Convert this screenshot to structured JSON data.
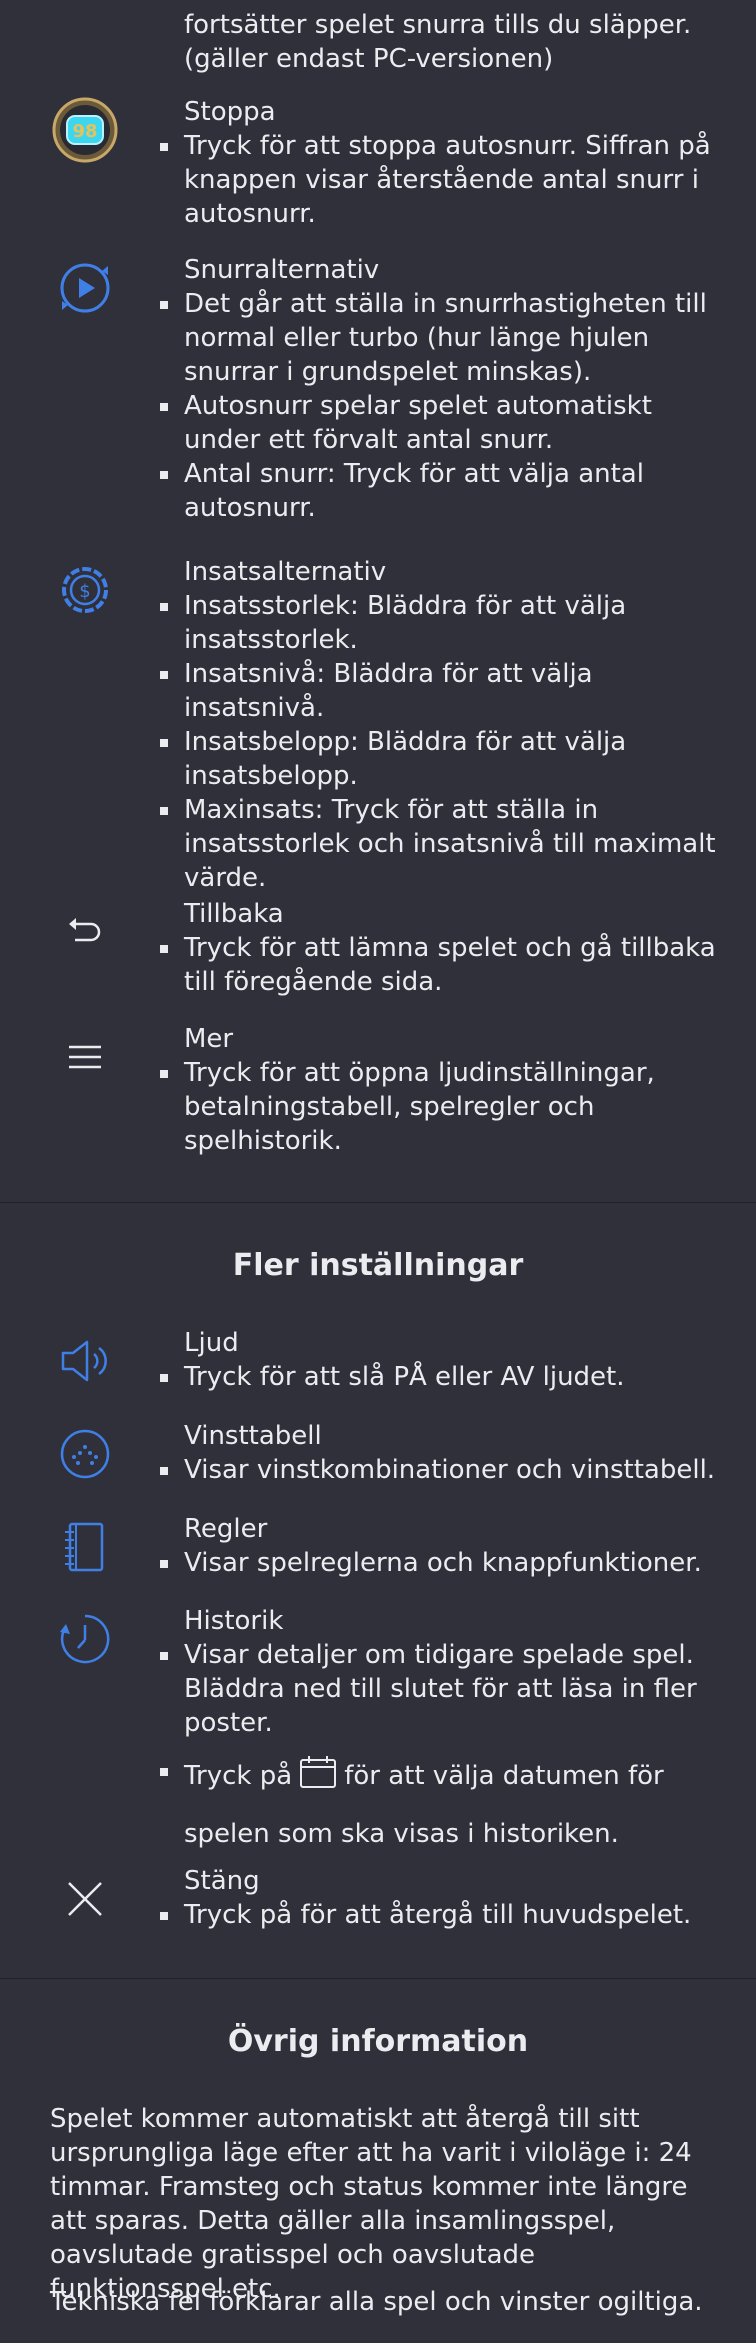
{
  "top_fragment": {
    "line1": "fortsätter spelet snurra tills du släpper.",
    "line2": "(gäller endast PC-versionen)"
  },
  "controls": {
    "stop": {
      "icon": "stop-badge-icon",
      "badge_number": "98",
      "title": "Stoppa",
      "bullets": [
        "Tryck för att stoppa autosnurr. Siffran på knappen visar återstående antal snurr i autosnurr."
      ]
    },
    "spin_options": {
      "icon": "play-circle-icon",
      "title": "Snurralternativ",
      "bullets": [
        "Det går att ställa in snurrhastigheten till normal eller turbo (hur länge hjulen snurrar i grundspelet minskas).",
        "Autosnurr spelar spelet automatiskt under ett förvalt antal snurr.",
        "Antal snurr: Tryck för att välja antal autosnurr."
      ]
    },
    "bet_options": {
      "icon": "coin-gear-icon",
      "title": "Insatsalternativ",
      "bullets": [
        "Insatsstorlek: Bläddra för att välja insatsstorlek.",
        "Insatsnivå: Bläddra för att välja insatsnivå.",
        "Insatsbelopp: Bläddra för att välja insatsbelopp.",
        "Maxinsats: Tryck för att ställa in insatsstorlek och insatsnivå till maximalt värde."
      ]
    },
    "back": {
      "icon": "back-arrow-icon",
      "title": "Tillbaka",
      "bullets": [
        "Tryck för att lämna spelet och gå tillbaka till föregående sida."
      ]
    },
    "more": {
      "icon": "menu-icon",
      "title": "Mer",
      "bullets": [
        "Tryck för att öppna ljudinställningar, betalningstabell, spelregler och spelhistorik."
      ]
    }
  },
  "more_settings": {
    "heading": "Fler inställningar",
    "sound": {
      "icon": "speaker-icon",
      "title": "Ljud",
      "bullets": [
        "Tryck för att slå PÅ eller AV ljudet."
      ]
    },
    "paytable": {
      "icon": "dots-circle-icon",
      "title": "Vinsttabell",
      "bullets": [
        "Visar vinstkombinationer och vinsttabell."
      ]
    },
    "rules": {
      "icon": "notebook-icon",
      "title": "Regler",
      "bullets": [
        "Visar spelreglerna och knappfunktioner."
      ]
    },
    "history": {
      "icon": "clock-icon",
      "title": "Historik",
      "bullets": [
        "Visar detaljer om tidigare spelade spel. Bläddra ned till slutet för att läsa in fler poster."
      ],
      "calendar_prefix": "Tryck på",
      "calendar_icon": "calendar-icon",
      "calendar_suffix": "för att välja datumen för",
      "calendar_line2": "spelen som ska visas i historiken."
    },
    "close": {
      "icon": "close-icon",
      "title": "Stäng",
      "bullets": [
        "Tryck på för att återgå till huvudspelet."
      ]
    }
  },
  "other_info": {
    "heading": "Övrig information",
    "paragraphs": [
      "Spelet kommer automatiskt att återgå till sitt ursprungliga läge efter att ha varit i viloläge i: 24 timmar. Framsteg och status kommer inte längre att sparas. Detta gäller alla insamlingsspel, oavslutade gratisspel och oavslutade funktionsspel etc.",
      "Tekniska fel förklarar alla spel och vinster ogiltiga."
    ]
  },
  "colors": {
    "background": "#30303a",
    "text": "#ececf0",
    "icon_blue": "#3f7fe6",
    "badge_cyan": "#3cd6f0"
  }
}
